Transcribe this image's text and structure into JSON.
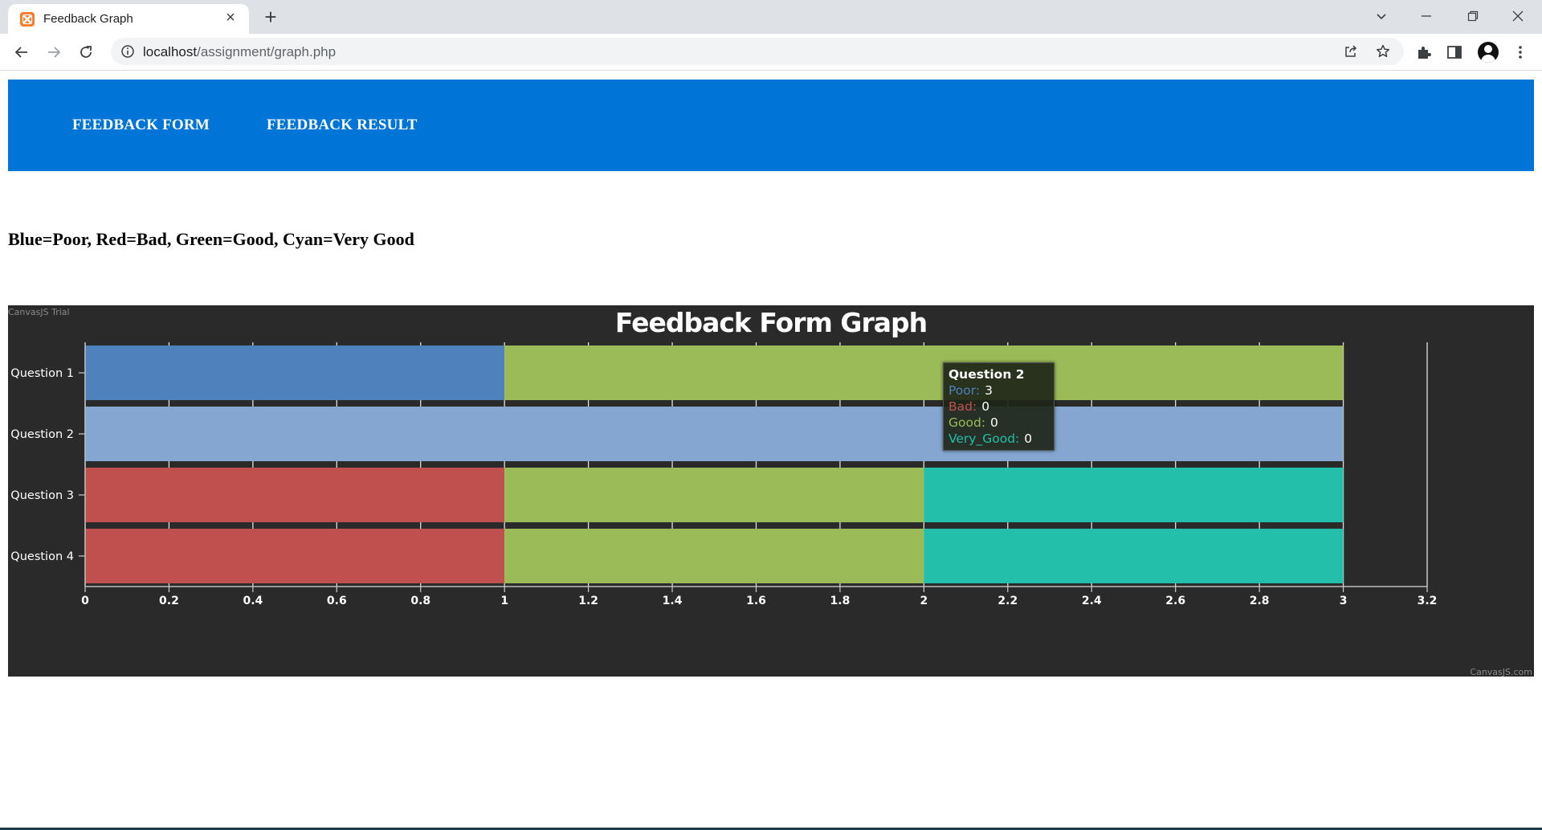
{
  "browser": {
    "tab_title": "Feedback Graph",
    "url_host": "localhost",
    "url_path": "/assignment/graph.php"
  },
  "nav": {
    "links": [
      "FEEDBACK FORM",
      "FEEDBACK RESULT"
    ]
  },
  "legend_note": "Blue=Poor, Red=Bad, Green=Good, Cyan=Very Good",
  "chart_data": {
    "type": "bar",
    "orientation": "horizontal",
    "stacked": true,
    "title": "Feedback Form Graph",
    "watermark": "CanvasJS Trial",
    "credit": "CanvasJS.com",
    "categories": [
      "Question 1",
      "Question 2",
      "Question 3",
      "Question 4"
    ],
    "series": [
      {
        "name": "Poor",
        "color": "#4f81bc",
        "values": [
          1,
          3,
          0,
          0
        ]
      },
      {
        "name": "Bad",
        "color": "#c0504e",
        "values": [
          0,
          0,
          1,
          1
        ]
      },
      {
        "name": "Good",
        "color": "#9bbb58",
        "values": [
          2,
          0,
          1,
          1
        ]
      },
      {
        "name": "Very_Good",
        "color": "#23bfaa",
        "values": [
          0,
          0,
          1,
          1
        ]
      }
    ],
    "xlim": [
      0,
      3.2
    ],
    "ticks": [
      "0",
      "0.2",
      "0.4",
      "0.6",
      "0.8",
      "1",
      "1.2",
      "1.4",
      "1.6",
      "1.8",
      "2",
      "2.2",
      "2.4",
      "2.6",
      "2.8",
      "3",
      "3.2"
    ],
    "grid": true,
    "background": "#2a2a2a",
    "highlight_color": "#84a6d0"
  },
  "tooltip": {
    "title": "Question 2",
    "rows": [
      {
        "label": "Poor:",
        "value": "3",
        "color": "#4f81bc"
      },
      {
        "label": "Bad:",
        "value": "0",
        "color": "#c0504e"
      },
      {
        "label": "Good:",
        "value": "0",
        "color": "#9bbb58"
      },
      {
        "label": "Very_Good:",
        "value": "0",
        "color": "#23bfaa"
      }
    ]
  }
}
